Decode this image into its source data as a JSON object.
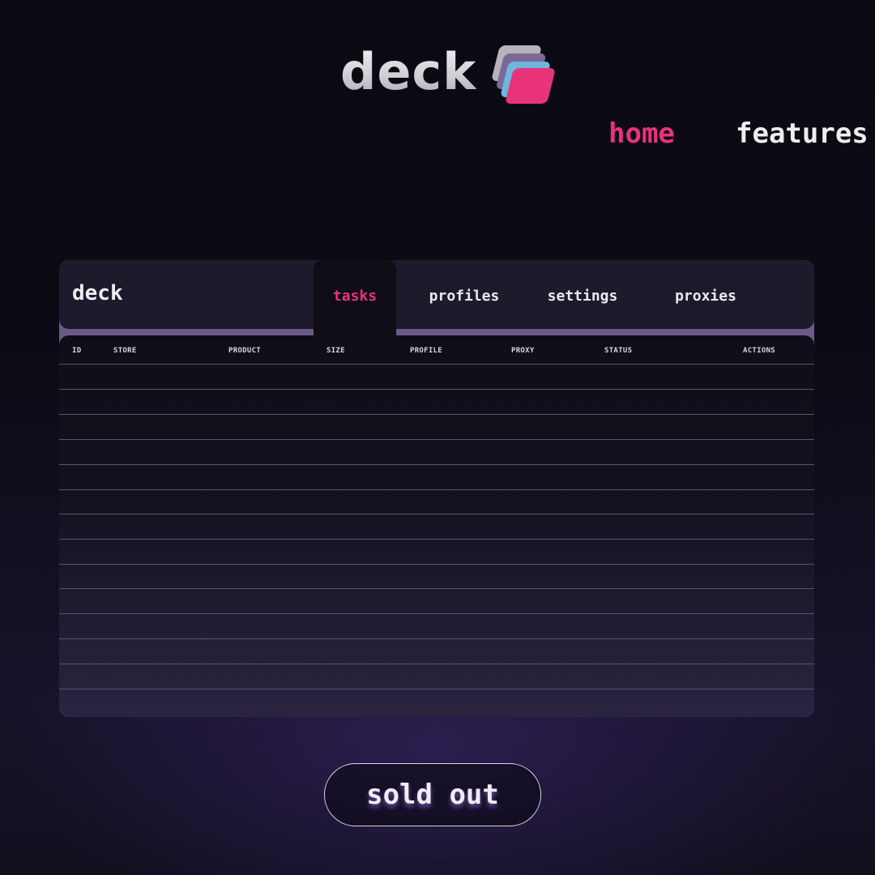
{
  "brand": {
    "name": "deck",
    "logo_icon": "stacked-cards-logo",
    "logo_colors": [
      "#b7b3bd",
      "#7b6a98",
      "#6fb6dc",
      "#e8337a"
    ]
  },
  "nav": {
    "items": [
      {
        "label": "home",
        "active": true
      },
      {
        "label": "features",
        "active": false
      }
    ],
    "active_color": "#e8337a"
  },
  "app": {
    "title": "deck",
    "tabs": [
      {
        "label": "tasks",
        "active": true
      },
      {
        "label": "profiles",
        "active": false
      },
      {
        "label": "settings",
        "active": false
      },
      {
        "label": "proxies",
        "active": false
      }
    ],
    "table": {
      "columns": [
        "ID",
        "STORE",
        "PRODUCT",
        "SIZE",
        "PROFILE",
        "PROXY",
        "STATUS",
        "ACTIONS"
      ],
      "rows": []
    }
  },
  "cta": {
    "label": "sold out"
  },
  "colors": {
    "accent": "#e8337a",
    "background": "#0c0b15",
    "panel": "#1e1a2c",
    "separator": "#6a5a8a"
  }
}
